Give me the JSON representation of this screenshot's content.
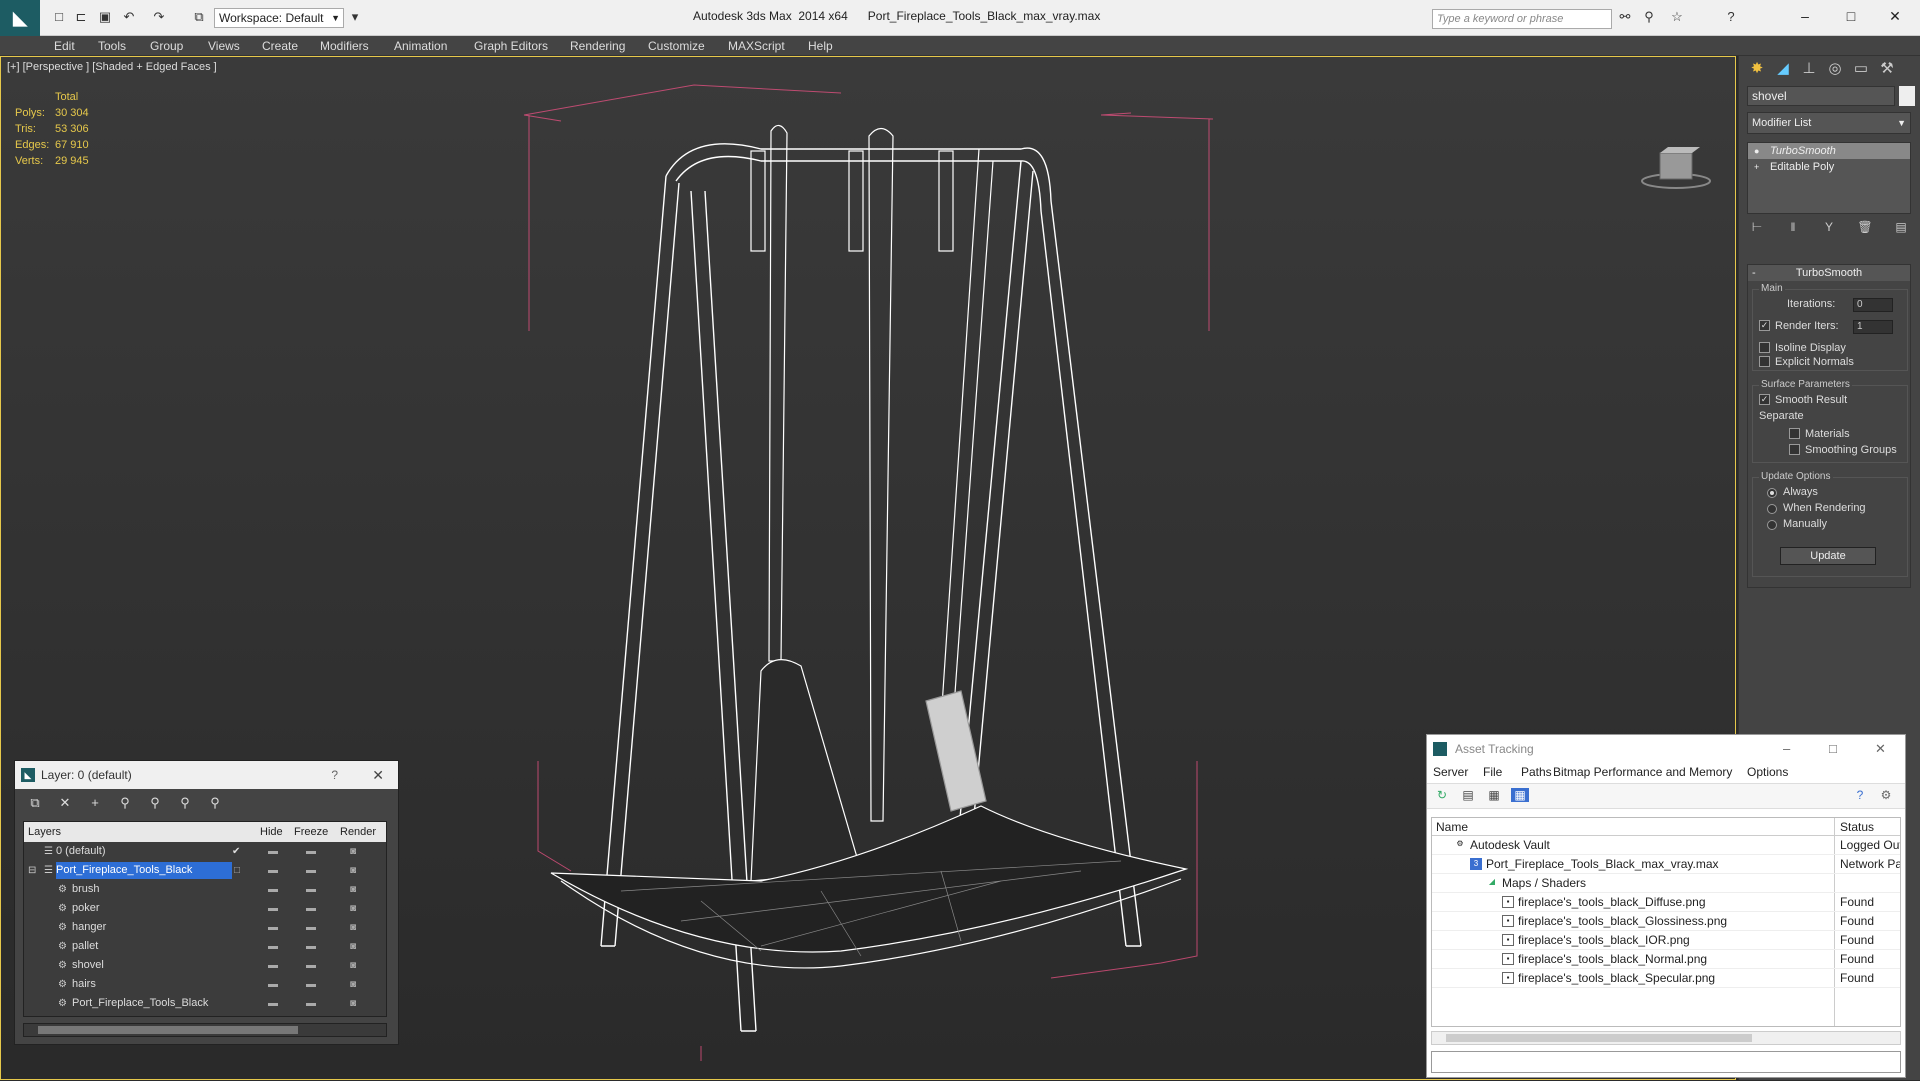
{
  "app": {
    "title": "Autodesk 3ds Max  2014 x64",
    "file": "Port_Fireplace_Tools_Black_max_vray.max",
    "workspace": "Workspace: Default",
    "search_placeholder": "Type a keyword or phrase"
  },
  "menu": [
    "Edit",
    "Tools",
    "Group",
    "Views",
    "Create",
    "Modifiers",
    "Animation",
    "Graph Editors",
    "Rendering",
    "Customize",
    "MAXScript",
    "Help"
  ],
  "viewport": {
    "label": "[+] [Perspective ] [Shaded + Edged Faces ]",
    "stats": {
      "header": "Total",
      "rows": [
        {
          "k": "Polys:",
          "v": "30 304"
        },
        {
          "k": "Tris:",
          "v": "53 306"
        },
        {
          "k": "Edges:",
          "v": "67 910"
        },
        {
          "k": "Verts:",
          "v": "29 945"
        }
      ]
    }
  },
  "command_panel": {
    "object_name": "shovel",
    "modifier_list": "Modifier List",
    "stack": [
      "TurboSmooth",
      "Editable Poly"
    ],
    "rollout": {
      "title": "TurboSmooth",
      "main_group": "Main",
      "iterations_label": "Iterations:",
      "iterations_value": "0",
      "render_iters_label": "Render Iters:",
      "render_iters_value": "1",
      "isoline": "Isoline Display",
      "explicit_normals": "Explicit Normals",
      "surface_group": "Surface Parameters",
      "smooth_result": "Smooth Result",
      "separate": "Separate",
      "materials": "Materials",
      "smoothing_groups": "Smoothing Groups",
      "update_group": "Update Options",
      "always": "Always",
      "when_rendering": "When Rendering",
      "manually": "Manually",
      "update_button": "Update"
    }
  },
  "layer_dialog": {
    "title": "Layer: 0 (default)",
    "help": "?",
    "columns": {
      "layers": "Layers",
      "hide": "Hide",
      "freeze": "Freeze",
      "render": "Render"
    },
    "rows": [
      {
        "name": "0 (default)",
        "level": 0
      },
      {
        "name": "Port_Fireplace_Tools_Black",
        "level": 0
      },
      {
        "name": "brush",
        "level": 1
      },
      {
        "name": "poker",
        "level": 1
      },
      {
        "name": "hanger",
        "level": 1
      },
      {
        "name": "pallet",
        "level": 1
      },
      {
        "name": "shovel",
        "level": 1
      },
      {
        "name": "hairs",
        "level": 1
      },
      {
        "name": "Port_Fireplace_Tools_Black",
        "level": 1
      }
    ]
  },
  "asset_dialog": {
    "title": "Asset Tracking",
    "menu": [
      "Server",
      "File",
      "Paths",
      "Bitmap Performance and Memory",
      "Options"
    ],
    "columns": {
      "name": "Name",
      "status": "Status"
    },
    "rows": [
      {
        "name": "Autodesk Vault",
        "status": "Logged Out",
        "level": 0
      },
      {
        "name": "Port_Fireplace_Tools_Black_max_vray.max",
        "status": "Network Path",
        "level": 1
      },
      {
        "name": "Maps / Shaders",
        "status": "",
        "level": 2
      },
      {
        "name": "fireplace's_tools_black_Diffuse.png",
        "status": "Found",
        "level": 3
      },
      {
        "name": "fireplace's_tools_black_Glossiness.png",
        "status": "Found",
        "level": 3
      },
      {
        "name": "fireplace's_tools_black_IOR.png",
        "status": "Found",
        "level": 3
      },
      {
        "name": "fireplace's_tools_black_Normal.png",
        "status": "Found",
        "level": 3
      },
      {
        "name": "fireplace's_tools_black_Specular.png",
        "status": "Found",
        "level": 3
      }
    ]
  }
}
